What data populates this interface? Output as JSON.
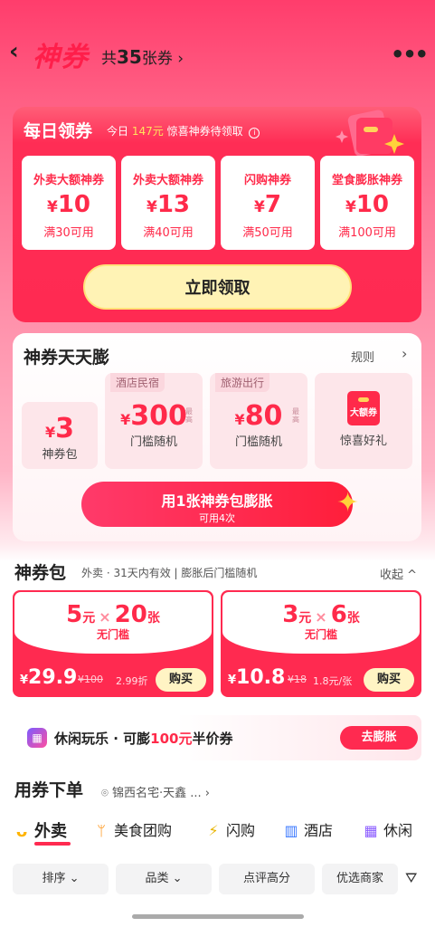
{
  "header": {
    "back_icon": "chevron-left-icon",
    "logo": "神券",
    "total_prefix": "共",
    "total_count": "35",
    "total_suffix": "张券 ›",
    "more_icon": "more-dots-icon"
  },
  "daily": {
    "title": "每日领券",
    "sub_prefix": "今日",
    "sub_amount": "147元",
    "sub_suffix": "惊喜神券待领取",
    "info_icon": "i",
    "coupons": [
      {
        "name": "外卖大额神券",
        "symbol": "¥",
        "value": "10",
        "cond": "满30可用"
      },
      {
        "name": "外卖大额神券",
        "symbol": "¥",
        "value": "13",
        "cond": "满40可用"
      },
      {
        "name": "闪购神券",
        "symbol": "¥",
        "value": "7",
        "cond": "满50可用"
      },
      {
        "name": "堂食膨胀神券",
        "symbol": "¥",
        "value": "10",
        "cond": "满100可用"
      }
    ],
    "claim_label": "立即领取"
  },
  "swell": {
    "title": "神券天天膨",
    "rule_label": "规则",
    "tiles": [
      {
        "symbol": "¥",
        "value": "3",
        "label": "神券包"
      },
      {
        "tag": "酒店民宿",
        "symbol": "¥",
        "value": "300",
        "vtag": "最高",
        "label": "门槛随机"
      },
      {
        "tag": "旅游出行",
        "symbol": "¥",
        "value": "80",
        "vtag": "最高",
        "label": "门槛随机"
      },
      {
        "pk_text": "大额券",
        "label": "惊喜好礼"
      }
    ],
    "use_label": "用1张神券包膨胀",
    "use_sub": "可用4次"
  },
  "pack": {
    "title": "神券包",
    "sub": "外卖 · 31天内有效 | 膨胀后门槛随机",
    "collapse_label": "收起 ^",
    "items": [
      {
        "amount": "5",
        "unit": "元",
        "times": "×",
        "count": "20",
        "count_unit": "张",
        "sub": "无门槛",
        "symbol": "¥",
        "price": "29.9",
        "orig": "¥100",
        "disc": "2.99折",
        "buy": "购买"
      },
      {
        "amount": "3",
        "unit": "元",
        "times": "×",
        "count": "6",
        "count_unit": "张",
        "sub": "无门槛",
        "symbol": "¥",
        "price": "10.8",
        "orig": "¥18",
        "disc": "1.8元/张",
        "buy": "购买"
      }
    ]
  },
  "banner": {
    "text_prefix": "休闲玩乐 · 可膨",
    "amount": "100元",
    "text_suffix": "半价券",
    "button": "去膨胀"
  },
  "order": {
    "title": "用券下单",
    "location": "锦西名宅·天鑫 ... ›",
    "categories": [
      "外卖",
      "美食团购",
      "闪购",
      "酒店",
      "休闲"
    ],
    "filters": [
      "排序 ⌄",
      "品类 ⌄",
      "点评高分",
      "优选商家"
    ]
  },
  "colors": {
    "accent": "#ff2a4a",
    "claim_bg": "#fff3b5"
  }
}
